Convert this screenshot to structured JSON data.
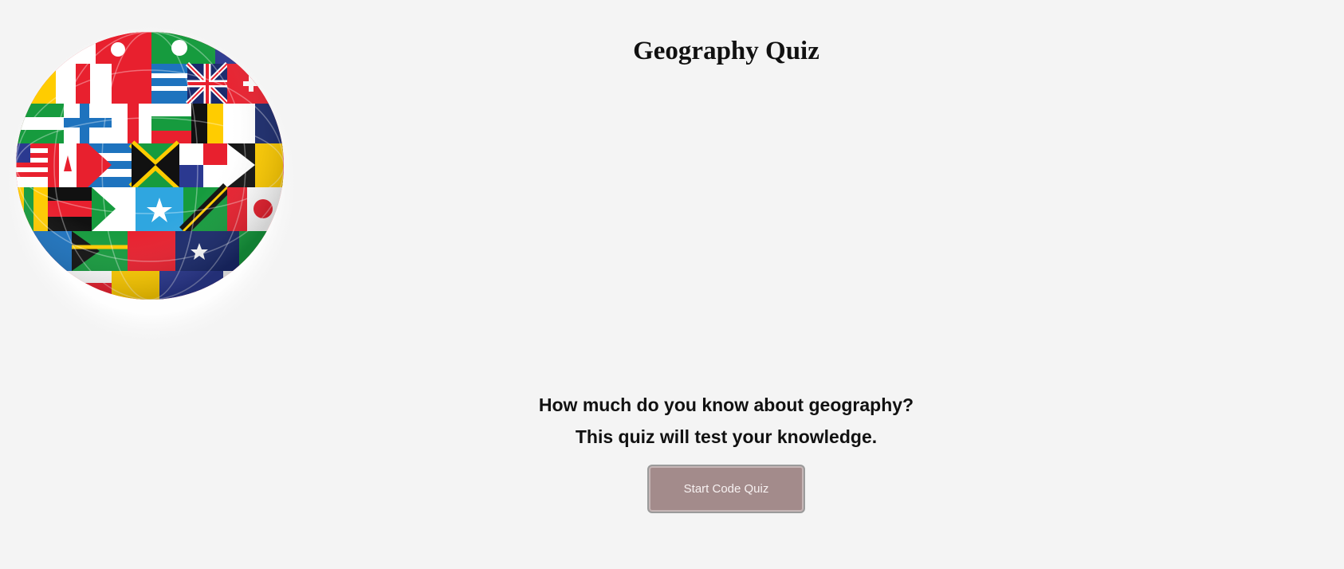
{
  "header": {
    "title": "Geography Quiz"
  },
  "logo": {
    "description_icon": "flag-globe-icon"
  },
  "intro": {
    "line1": "How much do you know about geography?",
    "line2": "This quiz will test your knowledge."
  },
  "actions": {
    "start_label": "Start Code Quiz"
  },
  "colors": {
    "background": "#f4f4f4",
    "button": "#a38b8b",
    "button_text": "#f7f1f1",
    "title_text": "#111111"
  }
}
